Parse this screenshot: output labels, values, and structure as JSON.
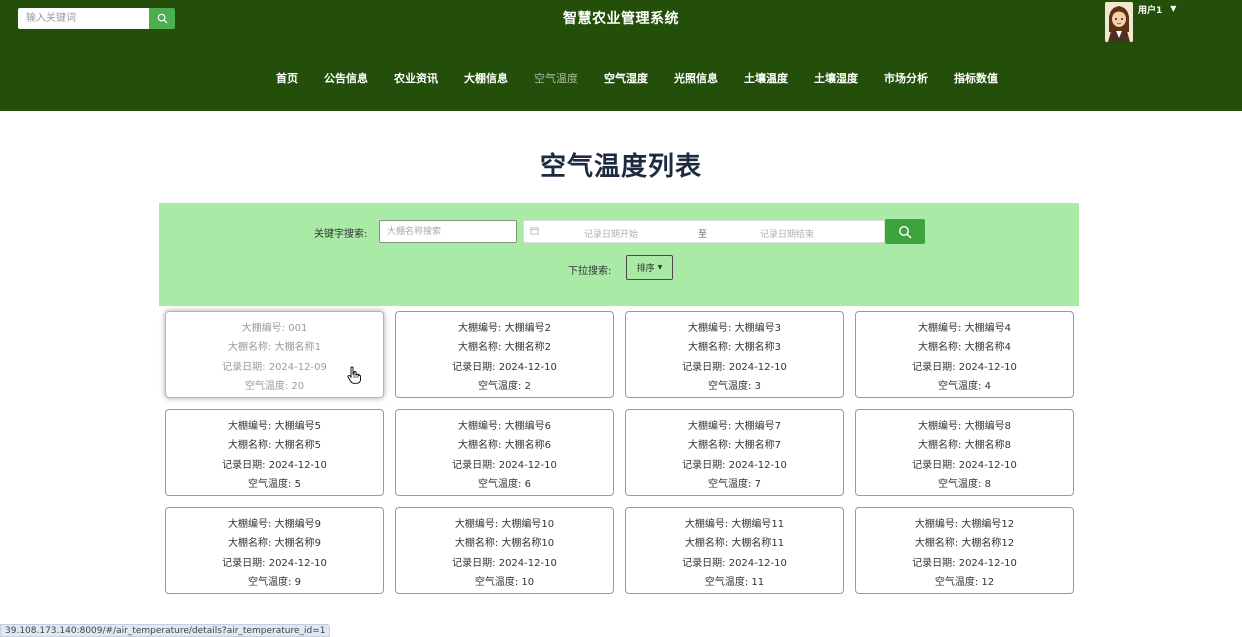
{
  "header": {
    "search_placeholder": "输入关键词",
    "site_title": "智慧农业管理系统",
    "user_name": "用户1",
    "nav": [
      {
        "label": "首页",
        "active": false
      },
      {
        "label": "公告信息",
        "active": false
      },
      {
        "label": "农业资讯",
        "active": false
      },
      {
        "label": "大棚信息",
        "active": false
      },
      {
        "label": "空气温度",
        "active": true
      },
      {
        "label": "空气湿度",
        "active": false
      },
      {
        "label": "光照信息",
        "active": false
      },
      {
        "label": "土壤温度",
        "active": false
      },
      {
        "label": "土壤湿度",
        "active": false
      },
      {
        "label": "市场分析",
        "active": false
      },
      {
        "label": "指标数值",
        "active": false
      }
    ]
  },
  "page_title": "空气温度列表",
  "filter": {
    "keyword_label": "关键字搜索:",
    "keyword_placeholder": "大棚名称搜索",
    "date_start_placeholder": "记录日期开始",
    "date_separator": "至",
    "date_end_placeholder": "记录日期结束",
    "sort_label": "下拉搜索:",
    "sort_button": "排序"
  },
  "cards": [
    {
      "id_line": "大棚编号: 001",
      "name_line": "大棚名称: 大棚名称1",
      "date_line": "记录日期: 2024-12-09",
      "temp_line": "空气温度: 20"
    },
    {
      "id_line": "大棚编号: 大棚编号2",
      "name_line": "大棚名称: 大棚名称2",
      "date_line": "记录日期: 2024-12-10",
      "temp_line": "空气温度: 2"
    },
    {
      "id_line": "大棚编号: 大棚编号3",
      "name_line": "大棚名称: 大棚名称3",
      "date_line": "记录日期: 2024-12-10",
      "temp_line": "空气温度: 3"
    },
    {
      "id_line": "大棚编号: 大棚编号4",
      "name_line": "大棚名称: 大棚名称4",
      "date_line": "记录日期: 2024-12-10",
      "temp_line": "空气温度: 4"
    },
    {
      "id_line": "大棚编号: 大棚编号5",
      "name_line": "大棚名称: 大棚名称5",
      "date_line": "记录日期: 2024-12-10",
      "temp_line": "空气温度: 5"
    },
    {
      "id_line": "大棚编号: 大棚编号6",
      "name_line": "大棚名称: 大棚名称6",
      "date_line": "记录日期: 2024-12-10",
      "temp_line": "空气温度: 6"
    },
    {
      "id_line": "大棚编号: 大棚编号7",
      "name_line": "大棚名称: 大棚名称7",
      "date_line": "记录日期: 2024-12-10",
      "temp_line": "空气温度: 7"
    },
    {
      "id_line": "大棚编号: 大棚编号8",
      "name_line": "大棚名称: 大棚名称8",
      "date_line": "记录日期: 2024-12-10",
      "temp_line": "空气温度: 8"
    },
    {
      "id_line": "大棚编号: 大棚编号9",
      "name_line": "大棚名称: 大棚名称9",
      "date_line": "记录日期: 2024-12-10",
      "temp_line": "空气温度: 9"
    },
    {
      "id_line": "大棚编号: 大棚编号10",
      "name_line": "大棚名称: 大棚名称10",
      "date_line": "记录日期: 2024-12-10",
      "temp_line": "空气温度: 10"
    },
    {
      "id_line": "大棚编号: 大棚编号11",
      "name_line": "大棚名称: 大棚名称11",
      "date_line": "记录日期: 2024-12-10",
      "temp_line": "空气温度: 11"
    },
    {
      "id_line": "大棚编号: 大棚编号12",
      "name_line": "大棚名称: 大棚名称12",
      "date_line": "记录日期: 2024-12-10",
      "temp_line": "空气温度: 12"
    }
  ],
  "status_url": "39.108.173.140:8009/#/air_temperature/details?air_temperature_id=1",
  "colors": {
    "header_bg": "#234f0a",
    "filter_bg": "#a9eaa6",
    "button_green": "#3fa33d",
    "title_color": "#1d2a3f"
  },
  "icons": {
    "header_search": "search-icon",
    "query": "search-icon",
    "date": "calendar-icon",
    "sort": "caret-down-icon",
    "user_menu": "caret-down-icon"
  }
}
